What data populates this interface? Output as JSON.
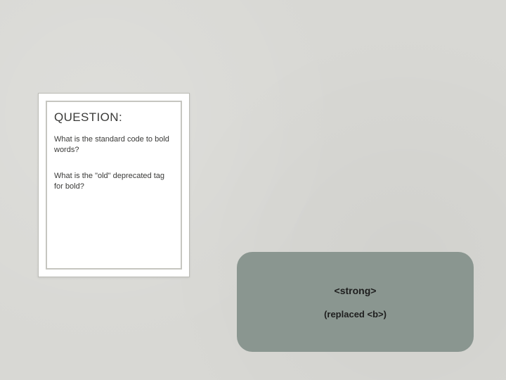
{
  "question_card": {
    "heading": "QUESTION:",
    "q1": "What is the standard code to bold words?",
    "q2": "What is the \"old\" deprecated tag for bold?"
  },
  "answer_card": {
    "main": "<strong>",
    "sub": "(replaced <b>)"
  }
}
